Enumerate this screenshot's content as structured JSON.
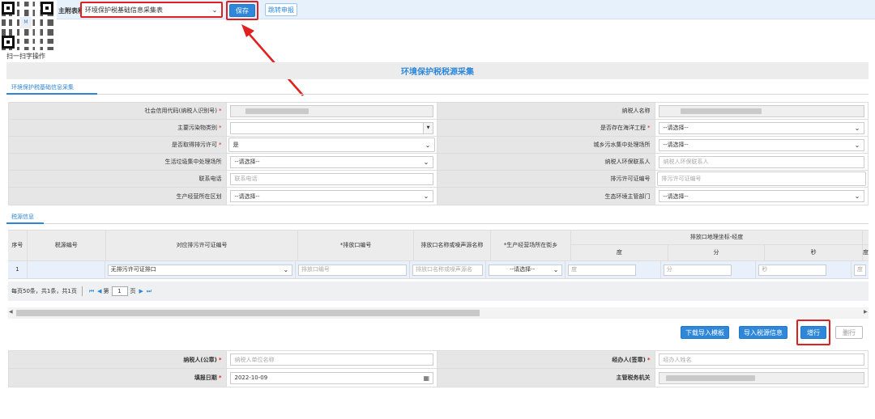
{
  "toolbar": {
    "main_form_label": "主附表种:",
    "main_form_value": "环境保护税基础信息采集表",
    "save_label": "保存",
    "jump_label": "跳转申报"
  },
  "qr": {
    "label": "扫一扫字操作",
    "center_text": "M"
  },
  "page_title": "环境保护税税源采集",
  "tab1": "环境保护税基础信息采集",
  "form": {
    "credit_code_label": "社会信用代码(纳税人识别号)",
    "taxpayer_name_label": "纳税人名称",
    "pollutant_type_label": "主要污染物类别",
    "ocean_project_label": "是否存在海洋工程",
    "ocean_project_value": "--请选择--",
    "permit_obtained_label": "是否取得排污许可",
    "permit_obtained_value": "是",
    "sewage_site_label": "城乡污水集中处理场所",
    "sewage_site_value": "--请选择--",
    "garbage_site_label": "生活垃圾集中处理场所",
    "garbage_site_value": "--请选择--",
    "env_contact_label": "纳税人环保联系人",
    "env_contact_placeholder": "纳税人环保联系人",
    "phone_label": "联系电话",
    "phone_placeholder": "联系电话",
    "permit_no_label": "排污许可证编号",
    "permit_no_placeholder": "排污许可证编号",
    "district_label": "生产经营所在区划",
    "district_value": "--请选择--",
    "eco_dept_label": "生态环境主管部门",
    "eco_dept_value": "--请选择--"
  },
  "tab2": "税源信息",
  "grid": {
    "headers": {
      "seq": "序号",
      "tax_source_no": "税源编号",
      "permit_no": "对应排污许可证编号",
      "outlet_no": "*排放口编号",
      "outlet_name": "排放口名称或噪声源名称",
      "street": "*生产经营场所在街乡",
      "coord_group": "排放口地理坐标-经度",
      "deg": "度",
      "min": "分",
      "sec": "秒",
      "deg2": "度"
    },
    "row": {
      "seq": "1",
      "permit_no": "无排污许可证排口",
      "outlet_no_ph": "排放口编号",
      "outlet_name_ph": "排放口名称或噪声源名",
      "street_value": "--请选择--",
      "deg_ph": "度",
      "min_ph": "分",
      "sec_ph": "秒",
      "deg2_ph": "度"
    }
  },
  "pager": {
    "summary": "每页50条，共1条，共1页",
    "page_prefix": "第",
    "page_value": "1",
    "page_suffix": "页"
  },
  "actions": {
    "download_template": "下载导入模板",
    "import_source": "导入税源信息",
    "add_row": "增行",
    "delete_row": "删行"
  },
  "bottom": {
    "taxpayer_seal_label": "纳税人(公章)",
    "taxpayer_seal_placeholder": "纳税人单位名称",
    "handler_label": "经办人(签章)",
    "handler_placeholder": "经办人姓名",
    "fill_date_label": "填报日期",
    "fill_date_value": "2022-10-09",
    "tax_authority_label": "主管税务机关"
  },
  "colors": {
    "accent": "#2f87d9",
    "highlight": "#e02020"
  }
}
